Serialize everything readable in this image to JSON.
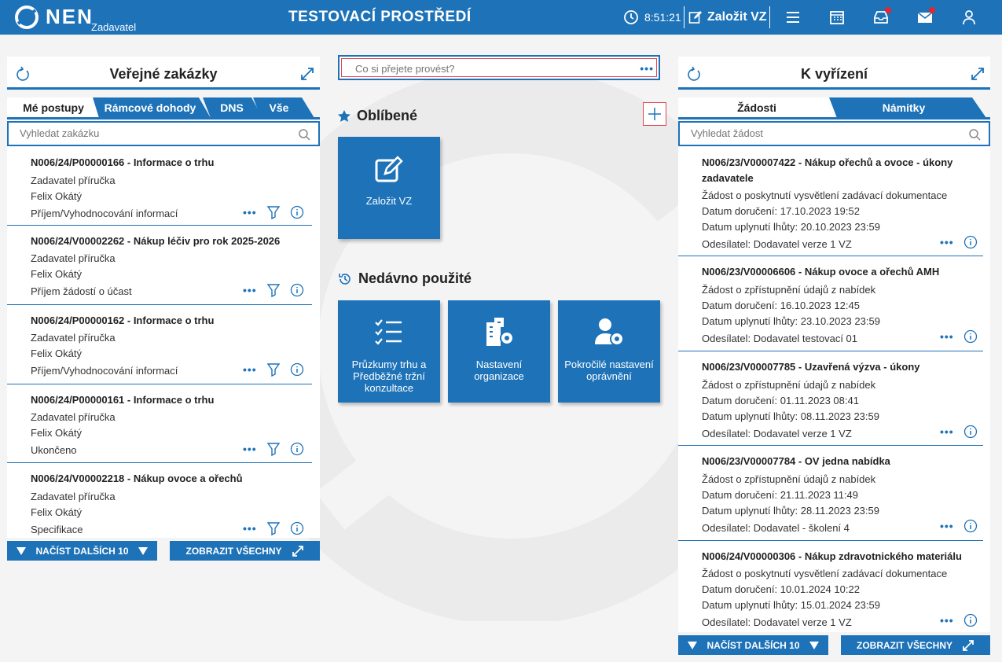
{
  "header": {
    "logo_text": "NEN",
    "logo_sub": "Zadavatel",
    "environment": "TESTOVACÍ PROSTŘEDÍ",
    "time": "8:51:21",
    "create_label": "Založit VZ"
  },
  "left_panel": {
    "title": "Veřejné zakázky",
    "tabs": [
      "Mé postupy",
      "Rámcové dohody",
      "DNS",
      "Vše"
    ],
    "search_placeholder": "Vyhledat zakázku",
    "items": [
      {
        "title": "N006/24/P00000166 - Informace o trhu",
        "line1": "Zadavatel příručka",
        "line2": "Felix Okátý",
        "status": "Příjem/Vyhodnocování informací"
      },
      {
        "title": "N006/24/V00002262 - Nákup léčiv pro rok 2025-2026",
        "line1": "Zadavatel příručka",
        "line2": "Felix Okátý",
        "status": "Příjem žádostí o účast"
      },
      {
        "title": "N006/24/P00000162 - Informace o trhu",
        "line1": "Zadavatel příručka",
        "line2": "Felix Okátý",
        "status": "Příjem/Vyhodnocování informací"
      },
      {
        "title": "N006/24/P00000161 - Informace o trhu",
        "line1": "Zadavatel příručka",
        "line2": "Felix Okátý",
        "status": "Ukončeno"
      },
      {
        "title": "N006/24/V00002218 - Nákup ovoce a ořechů",
        "line1": "Zadavatel příručka",
        "line2": "Felix Okátý",
        "status": "Specifikace"
      }
    ],
    "load_more": "NAČÍST DALŠÍCH 10",
    "show_all": "ZOBRAZIT VŠECHNY"
  },
  "middle": {
    "command_placeholder": "Co si přejete provést?",
    "favorites_title": "Oblíbené",
    "favorites": [
      {
        "label": "Založit VZ",
        "icon": "edit-icon"
      }
    ],
    "recent_title": "Nedávno použité",
    "recent": [
      {
        "label": "Průzkumy trhu a Předběžné tržní konzultace",
        "icon": "checklist-icon"
      },
      {
        "label": "Nastavení organizace",
        "icon": "building-gear-icon"
      },
      {
        "label": "Pokročilé nastavení oprávnění",
        "icon": "user-gear-icon"
      }
    ]
  },
  "right_panel": {
    "title": "K vyřízení",
    "tabs": [
      "Žádosti",
      "Námitky"
    ],
    "search_placeholder": "Vyhledat žádost",
    "items": [
      {
        "title1": "N006/23/V00007422 - Nákup ořechů a ovoce - úkony",
        "title2": "zadavatele",
        "type": "Žádost o poskytnutí vysvětlení zadávací dokumentace",
        "received": "Datum doručení: 17.10.2023 19:52",
        "deadline": "Datum uplynutí lhůty: 20.10.2023 23:59",
        "sender": "Odesílatel: Dodavatel verze 1 VZ"
      },
      {
        "title1": "N006/23/V00006606 - Nákup ovoce a ořechů AMH",
        "title2": "",
        "type": "Žádost o zpřístupnění údajů z nabídek",
        "received": "Datum doručení: 16.10.2023 12:45",
        "deadline": "Datum uplynutí lhůty: 23.10.2023 23:59",
        "sender": "Odesílatel: Dodavatel testovací 01"
      },
      {
        "title1": "N006/23/V00007785 - Uzavřená výzva - úkony",
        "title2": "",
        "type": "Žádost o zpřístupnění údajů z nabídek",
        "received": "Datum doručení: 01.11.2023 08:41",
        "deadline": "Datum uplynutí lhůty: 08.11.2023 23:59",
        "sender": "Odesílatel: Dodavatel verze 1 VZ"
      },
      {
        "title1": "N006/23/V00007784 - OV jedna nabídka",
        "title2": "",
        "type": "Žádost o zpřístupnění údajů z nabídek",
        "received": "Datum doručení: 21.11.2023 11:49",
        "deadline": "Datum uplynutí lhůty: 28.11.2023 23:59",
        "sender": "Odesílatel: Dodavatel - školení 4"
      },
      {
        "title1": "N006/24/V00000306 - Nákup zdravotnického materiálu",
        "title2": "",
        "type": "Žádost o poskytnutí vysvětlení zadávací dokumentace",
        "received": "Datum doručení: 10.01.2024 10:22",
        "deadline": "Datum uplynutí lhůty: 15.01.2024 23:59",
        "sender": "Odesílatel: Dodavatel verze 1 VZ"
      }
    ],
    "load_more": "NAČÍST DALŠÍCH 10",
    "show_all": "ZOBRAZIT VŠECHNY"
  },
  "colors": {
    "primary": "#1d72b8",
    "alert": "#e3262f",
    "background": "#f4f4f5"
  }
}
